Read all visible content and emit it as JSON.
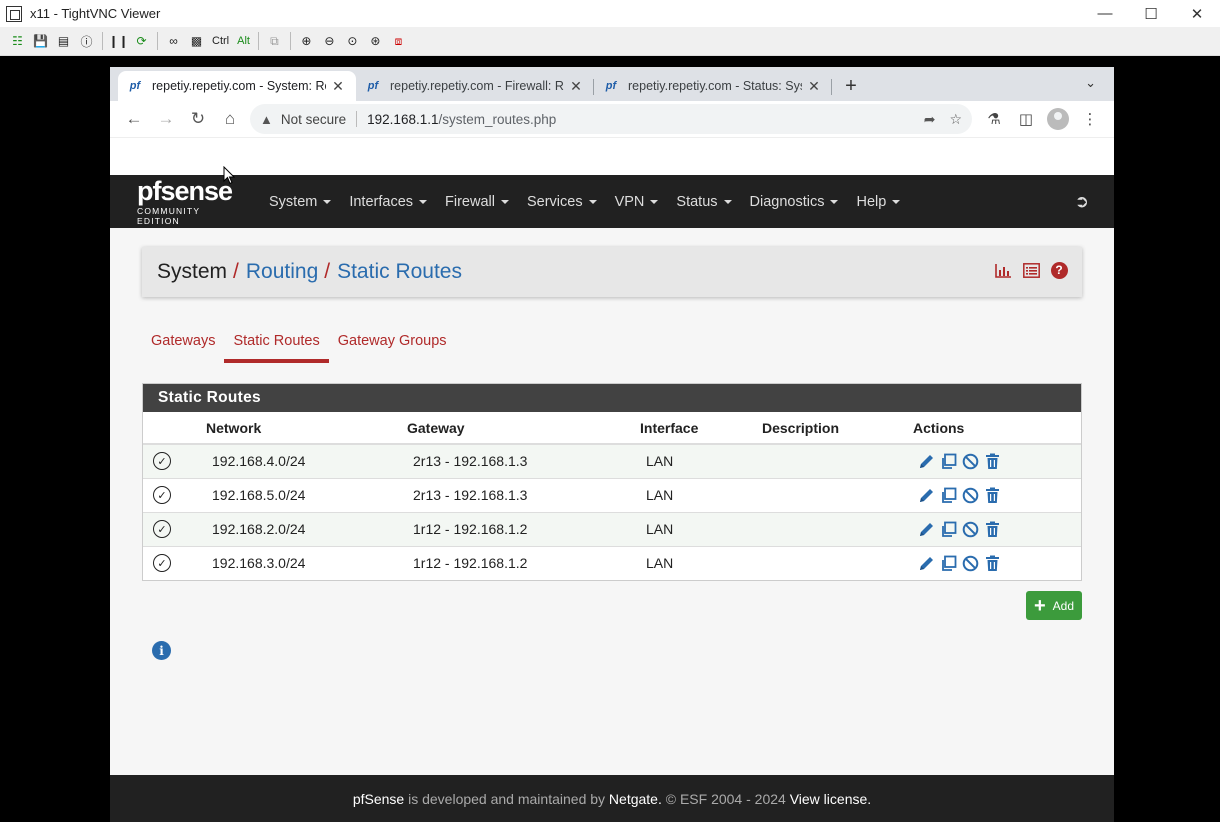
{
  "vnc": {
    "title": "x11 - TightVNC Viewer",
    "toolbar": {
      "ctrl": "Ctrl",
      "alt": "Alt"
    }
  },
  "browser": {
    "tabs": [
      {
        "title": "repetiy.repetiy.com - System: Routing: Static Routes"
      },
      {
        "title": "repetiy.repetiy.com - Firewall: Rules"
      },
      {
        "title": "repetiy.repetiy.com - Status: System Logs"
      }
    ],
    "address": {
      "security": "Not secure",
      "host": "192.168.1.1",
      "path": "/system_routes.php"
    }
  },
  "pfsense": {
    "logo_main": "pfsense",
    "logo_sub": "COMMUNITY EDITION",
    "menu": [
      "System",
      "Interfaces",
      "Firewall",
      "Services",
      "VPN",
      "Status",
      "Diagnostics",
      "Help"
    ],
    "breadcrumb": {
      "root": "System",
      "mid": "Routing",
      "last": "Static Routes"
    },
    "subtabs": [
      "Gateways",
      "Static Routes",
      "Gateway Groups"
    ],
    "panel_title": "Static Routes",
    "columns": [
      "Network",
      "Gateway",
      "Interface",
      "Description",
      "Actions"
    ],
    "rows": [
      {
        "network": "192.168.4.0/24",
        "gateway": "2r13 - 192.168.1.3",
        "interface": "LAN",
        "description": ""
      },
      {
        "network": "192.168.5.0/24",
        "gateway": "2r13 - 192.168.1.3",
        "interface": "LAN",
        "description": ""
      },
      {
        "network": "192.168.2.0/24",
        "gateway": "1r12 - 192.168.1.2",
        "interface": "LAN",
        "description": ""
      },
      {
        "network": "192.168.3.0/24",
        "gateway": "1r12 - 192.168.1.2",
        "interface": "LAN",
        "description": ""
      }
    ],
    "add_label": "Add",
    "footer": {
      "brand": "pfSense",
      "text1": " is developed and maintained by ",
      "company": "Netgate.",
      "text2": " © ESF 2004 - 2024 ",
      "license": "View license."
    }
  },
  "colors": {
    "accent": "#b02a2a",
    "link": "#2a6cae",
    "add": "#3c9b3c",
    "nav": "#212121"
  }
}
